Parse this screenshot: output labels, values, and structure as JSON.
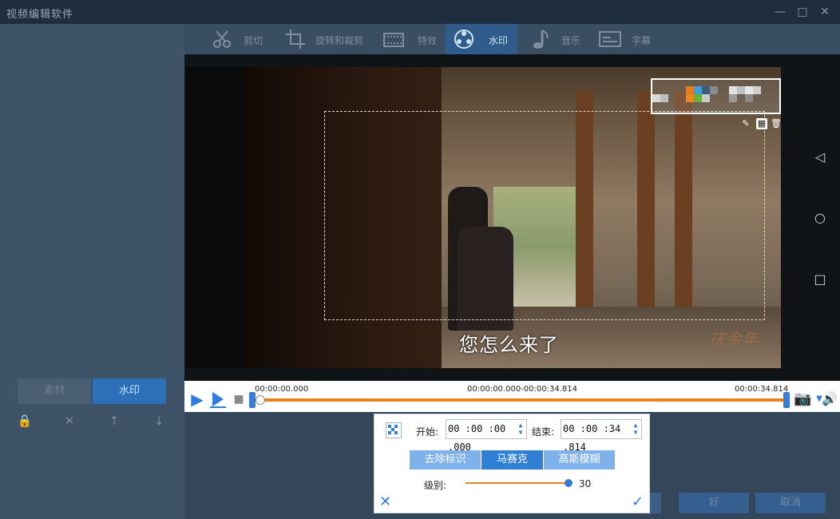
{
  "window": {
    "title": "视频编辑软件"
  },
  "tabs": [
    {
      "label": "剪切",
      "icon": "scissors-icon"
    },
    {
      "label": "旋转和裁剪",
      "icon": "crop-icon"
    },
    {
      "label": "特效",
      "icon": "film-effects-icon"
    },
    {
      "label": "水印",
      "icon": "reel-watermark-icon",
      "active": true
    },
    {
      "label": "音乐",
      "icon": "music-note-icon"
    },
    {
      "label": "字幕",
      "icon": "subtitle-icon"
    }
  ],
  "left_panel": {
    "tabs": [
      "素材",
      "水印"
    ],
    "active_tab": "水印"
  },
  "video": {
    "subtitle": "您怎么来了",
    "logo_text": "庆余年"
  },
  "playback": {
    "start_time": "00:00:00.000",
    "range": "00:00:00.000-00:00:34.814",
    "end_time": "00:00:34.814"
  },
  "dialog": {
    "start_label": "开始:",
    "start_value": "00 :00 :00 .000",
    "end_label": "结束:",
    "end_value": "00 :00 :34 .814",
    "modes": [
      "去除标识",
      "马赛克",
      "高斯模糊"
    ],
    "active_mode": "马赛克",
    "level_label": "级别:",
    "level_value": "30",
    "level_fraction": 1.0
  },
  "footer": {
    "ok_label": "好",
    "cancel_label": "取消"
  },
  "colors": {
    "accent": "#2f7fd4",
    "track": "#e8821f"
  }
}
